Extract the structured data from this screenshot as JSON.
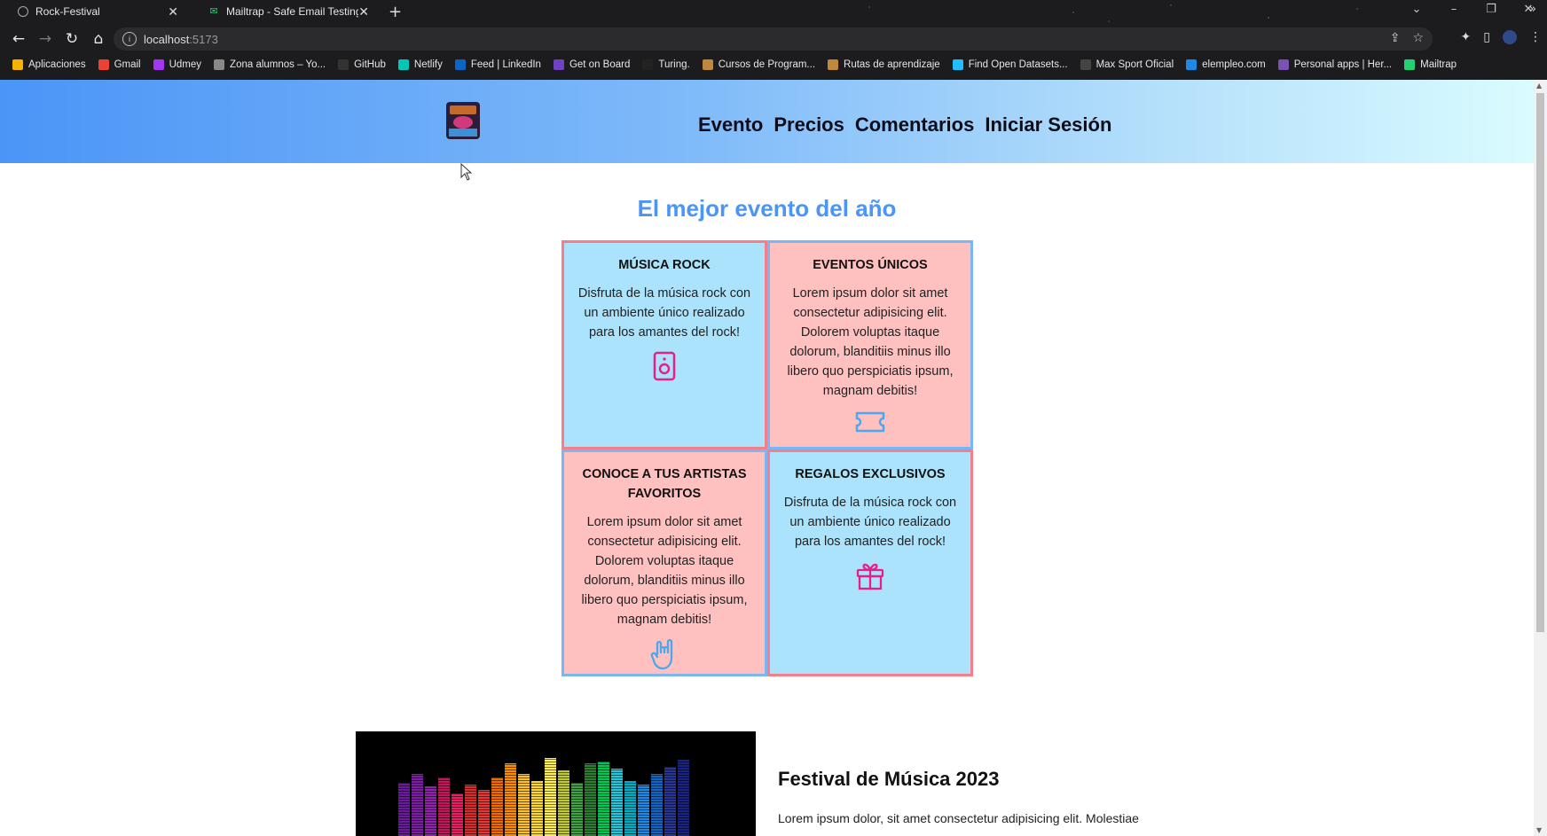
{
  "browser": {
    "tabs": [
      {
        "title": "Rock-Festival",
        "active": true
      },
      {
        "title": "Mailtrap - Safe Email Testing",
        "active": false
      }
    ],
    "new_tab": "+",
    "url_host": "localhost",
    "url_port": ":5173",
    "bookmarks": [
      {
        "label": "Aplicaciones",
        "icon": "apps-grid-icon",
        "color": "#f4b400"
      },
      {
        "label": "Gmail",
        "icon": "gmail-icon",
        "color": "#ea4335"
      },
      {
        "label": "Udmey",
        "icon": "udemy-icon",
        "color": "#a435f0"
      },
      {
        "label": "Zona alumnos – Yo...",
        "icon": "globe-icon",
        "color": "#888888"
      },
      {
        "label": "GitHub",
        "icon": "github-icon",
        "color": "#333333"
      },
      {
        "label": "Netlify",
        "icon": "netlify-icon",
        "color": "#00c7b7"
      },
      {
        "label": "Feed | LinkedIn",
        "icon": "linkedin-icon",
        "color": "#0a66c2"
      },
      {
        "label": "Get on Board",
        "icon": "getonboard-icon",
        "color": "#6f42c1"
      },
      {
        "label": "Turing.",
        "icon": "turing-icon",
        "color": "#222222"
      },
      {
        "label": "Cursos de Program...",
        "icon": "courses-icon",
        "color": "#c0883a"
      },
      {
        "label": "Rutas de aprendizaje",
        "icon": "routes-icon",
        "color": "#c0883a"
      },
      {
        "label": "Find Open Datasets...",
        "icon": "kaggle-icon",
        "color": "#20beff"
      },
      {
        "label": "Max Sport Oficial",
        "icon": "maxsport-icon",
        "color": "#444444"
      },
      {
        "label": "elempleo.com",
        "icon": "elempleo-icon",
        "color": "#1e88e5"
      },
      {
        "label": "Personal apps | Her...",
        "icon": "heroku-icon",
        "color": "#7952b3"
      },
      {
        "label": "Mailtrap",
        "icon": "mailtrap-icon",
        "color": "#22d172"
      }
    ]
  },
  "site": {
    "nav": [
      "Evento",
      "Precios",
      "Comentarios",
      "Iniciar Sesión"
    ],
    "hero_title": "El mejor evento del año",
    "cards": [
      {
        "title": "MÚSICA ROCK",
        "text": "Disfruta de la música rock con un ambiente único realizado para los amantes del rock!",
        "icon": "speaker-icon",
        "bg": "blue",
        "icon_color": "#e91e8c"
      },
      {
        "title": "EVENTOS ÚNICOS",
        "text": "Lorem ipsum dolor sit amet consectetur adipisicing elit. Dolorem voluptas itaque dolorum, blanditiis minus illo libero quo perspiciatis ipsum, magnam debitis!",
        "icon": "ticket-icon",
        "bg": "pink",
        "icon_color": "#4aa8f0"
      },
      {
        "title": "CONOCE A TUS ARTISTAS FAVORITOS",
        "text": "Lorem ipsum dolor sit amet consectetur adipisicing elit. Dolorem voluptas itaque dolorum, blanditiis minus illo libero quo perspiciatis ipsum, magnam debitis!",
        "icon": "rock-hand-icon",
        "bg": "pink",
        "icon_color": "#4aa8f0"
      },
      {
        "title": "REGALOS EXCLUSIVOS",
        "text": "Disfruta de la música rock con un ambiente único realizado para los amantes del rock!",
        "icon": "gift-icon",
        "bg": "blue",
        "icon_color": "#e91e8c"
      }
    ],
    "feature": {
      "title": "Festival de Música 2023",
      "text": "Lorem ipsum dolor, sit amet consectetur adipisicing elit. Molestiae"
    }
  },
  "colors": {
    "accent": "#4b95f7",
    "card_blue": "#aae3fb",
    "card_pink": "#ffc0c0",
    "border_pink": "#f47f8a",
    "border_blue": "#7ab6f3"
  }
}
